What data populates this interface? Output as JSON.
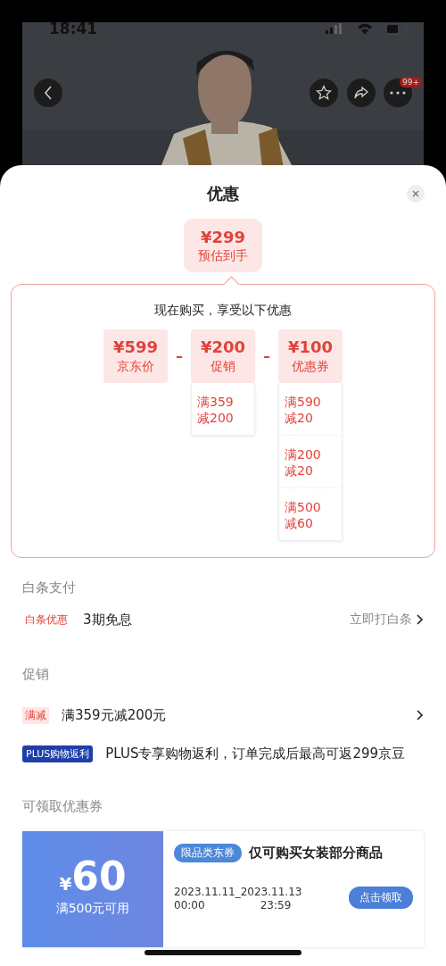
{
  "status_bar": {
    "time": "18:41"
  },
  "header": {
    "badge": "99+"
  },
  "sheet": {
    "title": "优惠"
  },
  "estimate": {
    "price": "¥299",
    "label": "预估到手"
  },
  "breakdown": {
    "heading": "现在购买，享受以下优惠",
    "items": [
      {
        "price": "¥599",
        "label": "京东价"
      },
      {
        "operator": "–",
        "price": "¥200",
        "label": "促销",
        "details": [
          {
            "line1": "满359",
            "line2": "减200"
          }
        ]
      },
      {
        "operator": "–",
        "price": "¥100",
        "label": "优惠券",
        "details": [
          {
            "line1": "满590",
            "line2": "减20"
          },
          {
            "line1": "满200",
            "line2": "减20"
          },
          {
            "line1": "满500",
            "line2": "减60"
          }
        ]
      }
    ]
  },
  "baitiao": {
    "title": "白条支付",
    "tag": "白条优惠",
    "text": "3期免息",
    "action": "立即打白条"
  },
  "promotions": {
    "title": "促销",
    "rows": [
      {
        "kind": "tag",
        "tag": "满减",
        "text": "满359元减200元",
        "arrow": true
      },
      {
        "kind": "plus",
        "tag": "PLUS购物返利",
        "text": "PLUS专享购物返利，订单完成后最高可返299京豆",
        "arrow": false
      }
    ]
  },
  "coupons": {
    "title": "可领取优惠券",
    "items": [
      {
        "currency": "¥",
        "amount": "60",
        "condition": "满500元可用",
        "tag": "限品类东券",
        "title": "仅可购买女装部分商品",
        "start_date": "2023.11.11",
        "start_time": "00:00",
        "separator": "_",
        "end_date": "2023.11.13",
        "end_time": "23:59",
        "button": "点击领取"
      }
    ]
  }
}
